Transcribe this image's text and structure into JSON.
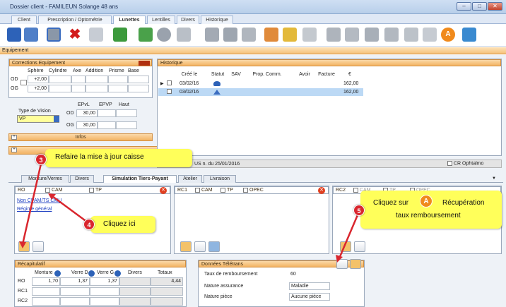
{
  "window": {
    "title": "Dossier client - FAMILEUN Solange 48 ans"
  },
  "tabs": [
    {
      "label": "Client"
    },
    {
      "label": "Prescription / Optométrie"
    },
    {
      "label": "Lunettes"
    },
    {
      "label": "Lentilles"
    },
    {
      "label": "Divers"
    },
    {
      "label": "Historique"
    }
  ],
  "section": {
    "title": "Equipement"
  },
  "corrections": {
    "title": "Corrections Equipement",
    "headers": [
      "Sphère",
      "Cylindre",
      "Axe",
      "Addition",
      "Prisme",
      "Base"
    ],
    "rows": [
      {
        "eye": "OD",
        "sphere": "+2,00"
      },
      {
        "eye": "OG",
        "sphere": "+2,00"
      }
    ]
  },
  "vision": {
    "label": "Type de Vision",
    "value": "VP",
    "ep_headers": [
      "EPvL",
      "EPVP",
      "Haut"
    ],
    "rows": [
      {
        "eye": "OD",
        "epvl": "30,00"
      },
      {
        "eye": "OG",
        "epvl": "30,00"
      }
    ],
    "infos": "Infos"
  },
  "historique": {
    "title": "Historique",
    "headers": [
      "Créé le",
      "Statut",
      "SAV",
      "Prop. Comm.",
      "Avoir",
      "Facture",
      "€"
    ],
    "rows": [
      {
        "date": "03/02/16",
        "amount": "162,00"
      },
      {
        "date": "03/02/16",
        "amount": "162,00"
      }
    ]
  },
  "banner": {
    "text": "US n. du 25/01/2016",
    "cr_label": "CR Ophtalmo"
  },
  "subtabs": [
    {
      "label": "Monture/Verres"
    },
    {
      "label": "Divers"
    },
    {
      "label": "Simulation Tiers-Payant"
    },
    {
      "label": "Atelier"
    },
    {
      "label": "Livraison"
    }
  ],
  "ro": {
    "title": "RO",
    "cb1": "CAM",
    "cb2": "TP",
    "links": [
      "Non CPAM/TS CMU",
      "Régime général"
    ]
  },
  "rc1": {
    "title": "RC1",
    "cb1": "CAM",
    "cb2": "TP",
    "cb3": "OPEC"
  },
  "rc2": {
    "title": "RC2",
    "cb1": "CAM",
    "cb2": "TP",
    "cb3": "OPEC"
  },
  "recap": {
    "title": "Récapitulatif",
    "headers": [
      "Monture",
      "Verre D",
      "Verre G",
      "Divers",
      "Totaux"
    ],
    "rows": [
      {
        "label": "RO",
        "values": [
          "1,70",
          "1,37",
          "1,37",
          "",
          "4,44"
        ]
      },
      {
        "label": "RC1",
        "values": [
          "",
          "",
          "",
          "",
          ""
        ]
      },
      {
        "label": "RC2",
        "values": [
          "",
          "",
          "",
          "",
          ""
        ]
      }
    ]
  },
  "teletrans": {
    "title": "Données Télétrans",
    "rows": [
      {
        "label": "Taux de remboursement",
        "value": "60"
      },
      {
        "label": "Nature assurance",
        "value": "Maladie"
      },
      {
        "label": "Nature pièce",
        "value": "Aucune pièce"
      }
    ]
  },
  "callouts": {
    "c3": "Refaire la mise à jour caisse",
    "c4": "Cliquez ici",
    "c5_line1a": "Cliquez sur",
    "c5_line1b": "Récupération",
    "c5_line2": "taux remboursement",
    "n3": "3",
    "n4": "4",
    "n5": "5"
  }
}
